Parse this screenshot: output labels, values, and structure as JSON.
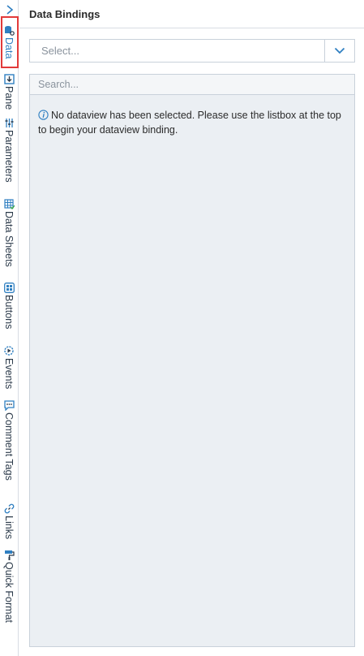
{
  "rail": {
    "tabs": [
      {
        "id": "data",
        "label": "Data",
        "icon": "database-search-icon"
      },
      {
        "id": "pane",
        "label": "Pane",
        "icon": "pane-download-icon"
      },
      {
        "id": "parameters",
        "label": "Parameters",
        "icon": "parameters-sliders-icon"
      },
      {
        "id": "data-sheets",
        "label": "Data Sheets",
        "icon": "data-sheet-check-icon"
      },
      {
        "id": "buttons",
        "label": "Buttons",
        "icon": "buttons-grid-icon"
      },
      {
        "id": "events",
        "label": "Events",
        "icon": "events-gear-play-icon"
      },
      {
        "id": "comment-tags",
        "label": "Comment Tags",
        "icon": "comment-icon"
      },
      {
        "id": "links",
        "label": "Links",
        "icon": "link-icon"
      },
      {
        "id": "quick-format",
        "label": "Quick Format",
        "icon": "paint-roller-icon"
      }
    ],
    "active": "data"
  },
  "header": {
    "title": "Data Bindings"
  },
  "dataview_select": {
    "placeholder": "Select..."
  },
  "search": {
    "placeholder": "Search..."
  },
  "message": "No dataview has been selected. Please use the listbox at the top to begin your dataview binding.",
  "colors": {
    "accent": "#2f7fc1",
    "highlight": "#e23a3a",
    "panel_bg": "#ebeff3"
  }
}
